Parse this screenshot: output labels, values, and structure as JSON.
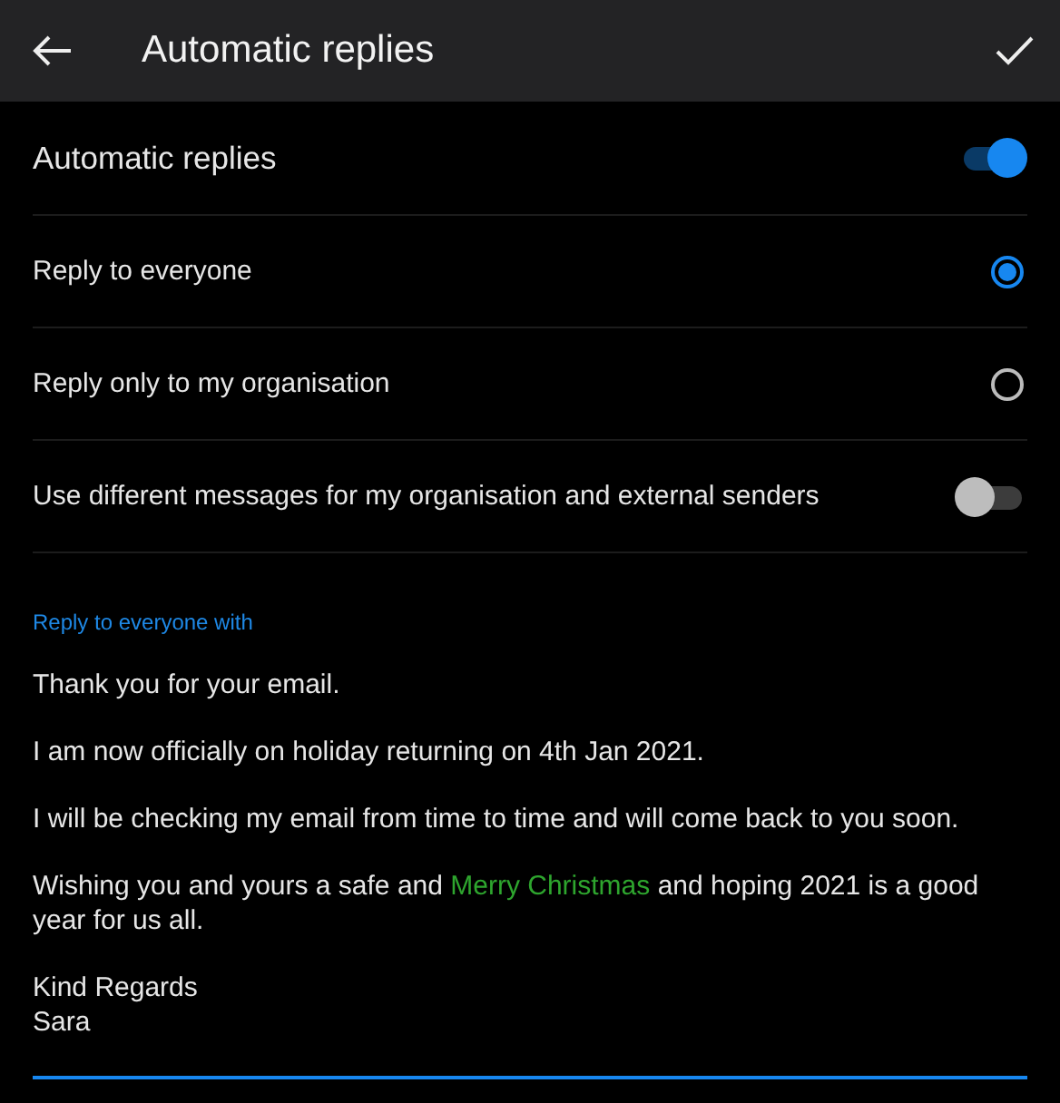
{
  "header": {
    "title": "Automatic replies"
  },
  "settings": [
    {
      "kind": "switch",
      "label": "Automatic replies",
      "on": true,
      "large": true
    },
    {
      "kind": "radio",
      "label": "Reply to everyone",
      "selected": true
    },
    {
      "kind": "radio",
      "label": "Reply only to my organisation",
      "selected": false
    },
    {
      "kind": "switch",
      "label": "Use different messages for my organisation and external senders",
      "on": false,
      "large": false
    }
  ],
  "message": {
    "label": "Reply to everyone with",
    "paragraphs": [
      {
        "parts": [
          {
            "text": "Thank you for your email.",
            "highlight": false
          }
        ]
      },
      {
        "parts": [
          {
            "text": "I am now officially on holiday returning on 4th Jan 2021.",
            "highlight": false
          }
        ]
      },
      {
        "parts": [
          {
            "text": "I will be checking my email from time to time and will come back to you soon.",
            "highlight": false
          }
        ]
      },
      {
        "parts": [
          {
            "text": "Wishing you and yours a safe and ",
            "highlight": false
          },
          {
            "text": "Merry Christmas",
            "highlight": true
          },
          {
            "text": " and hoping 2021 is a good year for us all.",
            "highlight": false
          }
        ]
      }
    ],
    "signature": [
      "Kind Regards",
      "Sara"
    ]
  }
}
